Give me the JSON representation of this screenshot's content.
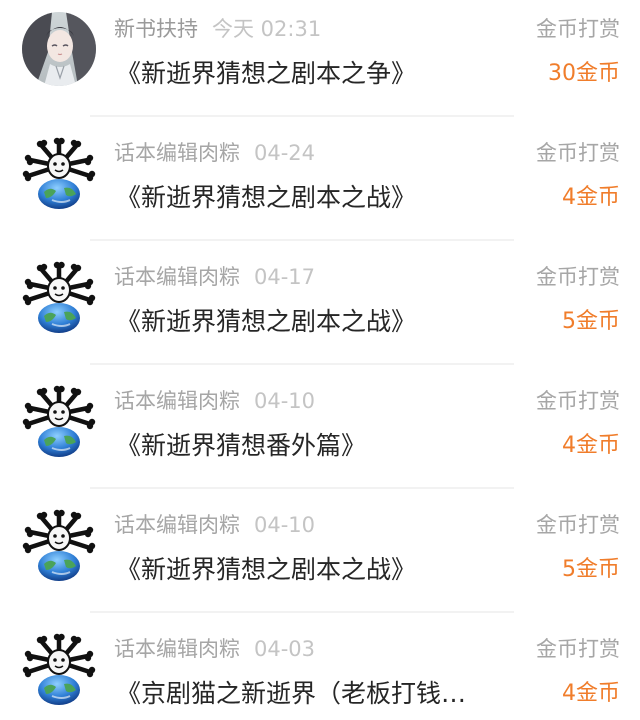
{
  "colors": {
    "sender": "#a6a6a6",
    "time": "#c4c4c4",
    "title": "#262626",
    "amount": "#f07d2b",
    "divider": "#f2f2f2"
  },
  "items": [
    {
      "avatar": "anime-character-avatar",
      "sender": "新书扶持",
      "time": "今天 02:31",
      "title": "《新逝界猜想之剧本之争》",
      "type": "金币打赏",
      "amount": "30金币"
    },
    {
      "avatar": "bones-skull-earth-avatar",
      "sender": "话本编辑肉粽",
      "time": "04-24",
      "title": "《新逝界猜想之剧本之战》",
      "type": "金币打赏",
      "amount": "4金币"
    },
    {
      "avatar": "bones-skull-earth-avatar",
      "sender": "话本编辑肉粽",
      "time": "04-17",
      "title": "《新逝界猜想之剧本之战》",
      "type": "金币打赏",
      "amount": "5金币"
    },
    {
      "avatar": "bones-skull-earth-avatar",
      "sender": "话本编辑肉粽",
      "time": "04-10",
      "title": "《新逝界猜想番外篇》",
      "type": "金币打赏",
      "amount": "4金币"
    },
    {
      "avatar": "bones-skull-earth-avatar",
      "sender": "话本编辑肉粽",
      "time": "04-10",
      "title": "《新逝界猜想之剧本之战》",
      "type": "金币打赏",
      "amount": "5金币"
    },
    {
      "avatar": "bones-skull-earth-avatar",
      "sender": "话本编辑肉粽",
      "time": "04-03",
      "title": "《京剧猫之新逝界（老板打钱…",
      "type": "金币打赏",
      "amount": "4金币"
    }
  ]
}
